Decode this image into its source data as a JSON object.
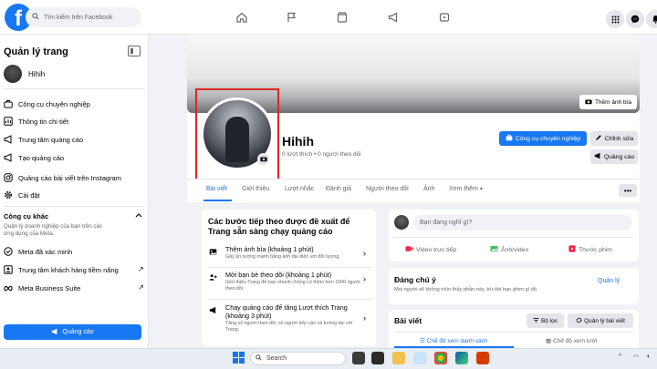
{
  "colors": {
    "accent": "#1877f2",
    "highlight_box": "#e02424",
    "background": "#f0f2f5"
  },
  "topbar": {
    "logo": "f",
    "search_placeholder": "Tìm kiếm trên Facebook",
    "nav_icons": [
      "home-icon",
      "flag-icon",
      "marketplace-icon",
      "megaphone-icon",
      "video-icon"
    ],
    "right_icons": [
      "menu-grid-icon",
      "messenger-icon",
      "bell-icon"
    ]
  },
  "sidebar": {
    "title": "Quản lý trang",
    "page_name": "Hihih",
    "items": [
      {
        "label": "Công cụ chuyên nghiệp",
        "icon": "briefcase-icon"
      },
      {
        "label": "Thông tin chi tiết",
        "icon": "insights-icon"
      },
      {
        "label": "Trung tâm quảng cáo",
        "icon": "ads-center-icon"
      },
      {
        "label": "Tạo quảng cáo",
        "icon": "create-ad-icon"
      },
      {
        "label": "Quảng cáo bài viết trên Instagram",
        "icon": "instagram-icon"
      },
      {
        "label": "Cài đặt",
        "icon": "gear-icon"
      }
    ],
    "other_title": "Công cụ khác",
    "other_desc": "Quản lý doanh nghiệp của bạn trên các ứng dụng của Meta.",
    "other_items": [
      {
        "label": "Meta đã xác minh",
        "icon": "verified-icon"
      },
      {
        "label": "Trung tâm khách hàng tiềm năng",
        "icon": "leads-icon"
      },
      {
        "label": "Meta Business Suite",
        "icon": "meta-icon"
      }
    ],
    "ad_button": "Quảng cáo"
  },
  "profile": {
    "cover_button": "Thêm ảnh bìa",
    "name": "Hihih",
    "stats": "0 lượt thích • 0 người theo dõi",
    "btn_tools": "Công cụ chuyên nghiệp",
    "btn_edit": "Chỉnh sửa",
    "btn_ad": "Quảng cáo",
    "tabs": [
      "Bài viết",
      "Giới thiệu",
      "Lượt nhắc",
      "Đánh giá",
      "Người theo dõi",
      "Ảnh",
      "Xem thêm"
    ],
    "more_button": "•••"
  },
  "steps": {
    "title": "Các bước tiếp theo được đề xuất để Trang sẵn sàng chạy quảng cáo",
    "items": [
      {
        "title": "Thêm ảnh bìa (khoảng 1 phút)",
        "desc": "Gây ấn tượng mạnh bằng ảnh đại diện với đối tượng.",
        "icon": "photo-icon"
      },
      {
        "title": "Mời bạn bè theo dõi (khoảng 1 phút)",
        "desc": "Giới thiệu Trang để bạn nhanh chóng có thêm hơn 1000 người theo dõi.",
        "icon": "invite-icon"
      },
      {
        "title": "Chạy quảng cáo để tăng Lượt thích Trang (khoảng 3 phút)",
        "desc": "Tăng số người theo dõi, số người tiếp cận và tương tác với Trang.",
        "icon": "megaphone-icon"
      }
    ]
  },
  "composer": {
    "placeholder": "Bạn đang nghĩ gì?",
    "actions": [
      {
        "label": "Video trực tiếp",
        "icon": "live-video-icon",
        "color": "#f02849"
      },
      {
        "label": "Ảnh/video",
        "icon": "photo-video-icon",
        "color": "#45bd62"
      },
      {
        "label": "Thước phim",
        "icon": "reels-icon",
        "color": "#e42645"
      }
    ]
  },
  "notice": {
    "title": "Đáng chú ý",
    "desc": "Mọi người sẽ không nhìn thấy phần này, trừ khi bạn ghim gì đó.",
    "manage": "Quản lý"
  },
  "posts": {
    "title": "Bài viết",
    "filter": "Bộ lọc",
    "manage": "Quản lý bài viết",
    "view_list": "Chế độ xem danh sách",
    "view_grid": "Chế độ xem lưới"
  },
  "taskbar": {
    "search": "Search"
  }
}
